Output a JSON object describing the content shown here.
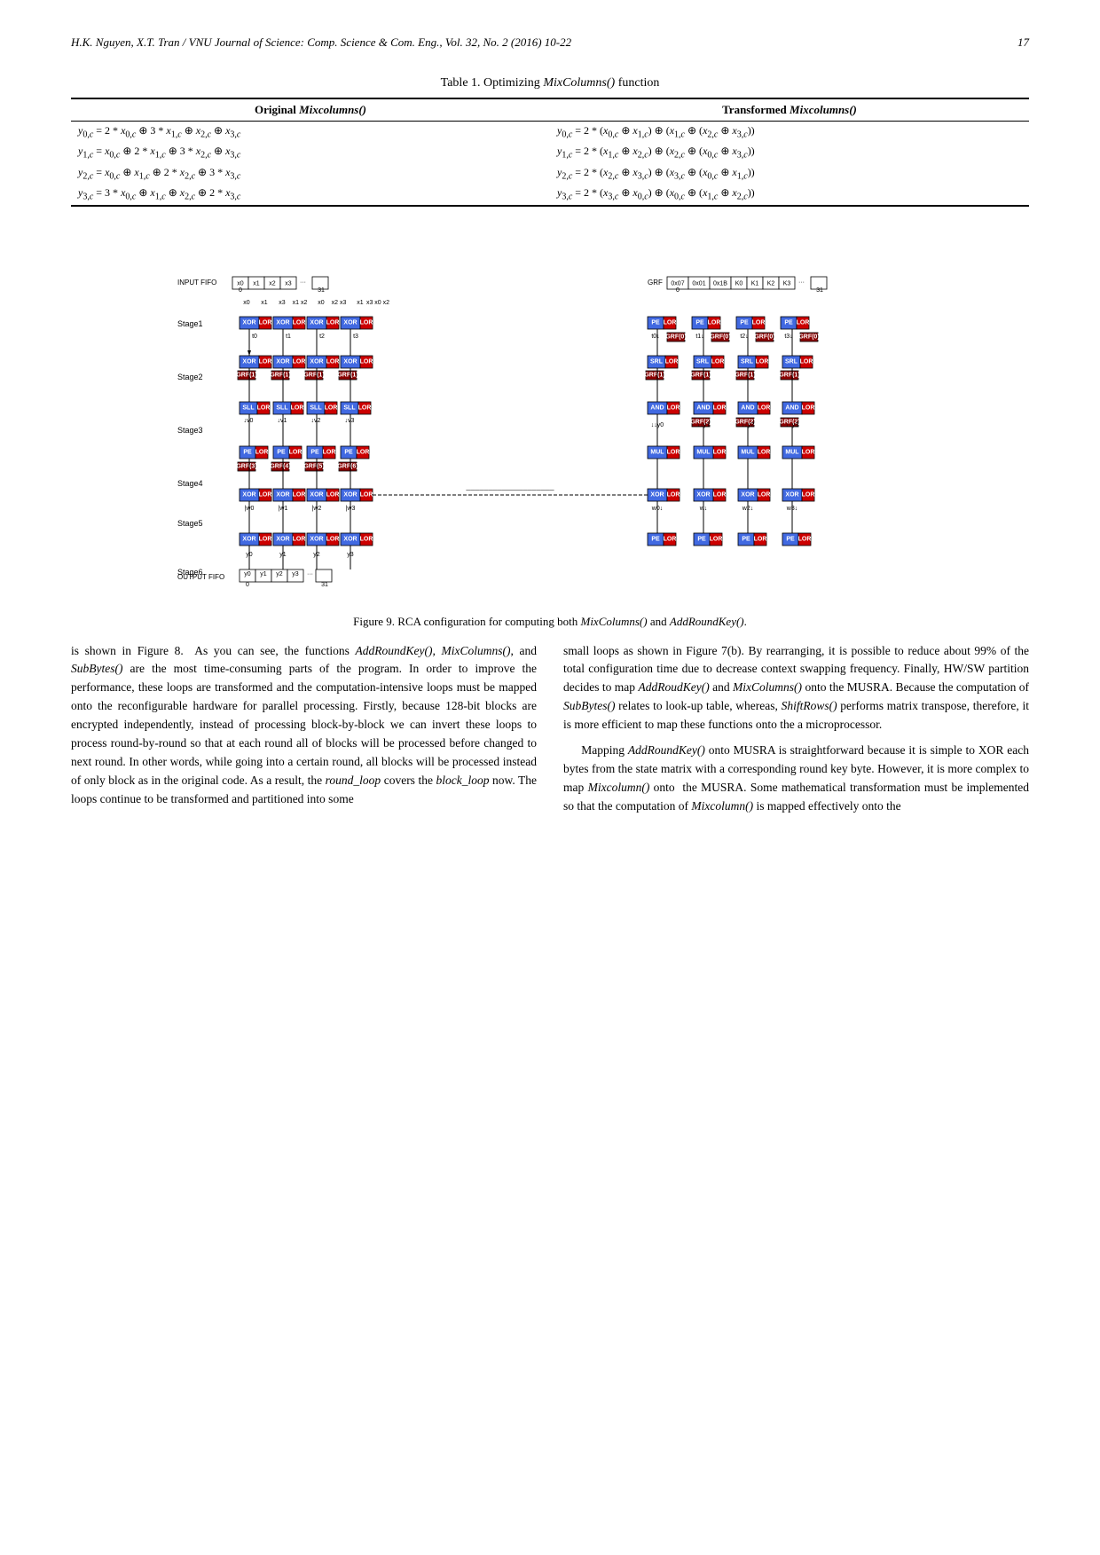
{
  "header": {
    "left": "H.K. Nguyen, X.T. Tran / VNU Journal of Science: Comp. Science & Com. Eng., Vol. 32, No. 2 (2016) 10-22",
    "right": "17"
  },
  "table": {
    "caption": "Table 1. Optimizing MixColumns() function",
    "col_headers": [
      "Original Mixcolumns()",
      "Transformed Mixcolumns()"
    ],
    "rows": [
      {
        "left": "y₀,c = 2 * x₀,c ⊕ 3 * x₁,c ⊕ x₂,c ⊕ x₃,c",
        "right": "y₀,c = 2 * (x₀,c ⊕ x₁,c) ⊕ (x₁,c ⊕ (x₂,c ⊕ x₃,c))"
      },
      {
        "left": "y₁,c = x₀,c ⊕ 2 * x₁,c ⊕ 3 * x₂,c ⊕ x₃,c",
        "right": "y₁,c = 2 * (x₁,c ⊕ x₂,c) ⊕ (x₂,c ⊕ (x₀,c ⊕ x₃,c))"
      },
      {
        "left": "y₂,c = x₀,c ⊕ x₁,c ⊕ 2 * x₂,c ⊕ 3 * x₃,c",
        "right": "y₂,c = 2 * (x₂,c ⊕ x₃,c) ⊕ (x₃,c ⊕ (x₀,c ⊕ x₁,c))"
      },
      {
        "left": "y₃,c = 3 * x₀,c ⊕ x₁,c ⊕ x₂,c ⊕ 2 * x₃,c",
        "right": "y₃,c = 2 * (x₃,c ⊕ x₀,c) ⊕ (x₀,c ⊕ (x₁,c ⊕ x₂,c))"
      }
    ]
  },
  "figure": {
    "caption_text": "Figure 9. RCA configuration for computing both ",
    "caption_func1": "MixColumns()",
    "caption_middle": " and ",
    "caption_func2": "AddRoundKey().",
    "number": "Figure 9"
  },
  "text_left": {
    "paragraphs": [
      "is shown in Figure 8.  As you can see, the functions AddRoundKey(), MixColumns(), and SubBytes() are the most time-consuming parts of the program. In order to improve the performance, these loops are transformed and the computation-intensive loops must be mapped onto the reconfigurable hardware for parallel processing. Firstly, because 128-bit blocks are encrypted independently, instead of processing block-by-block we can invert these loops to process round-by-round so that at each round all of blocks will be processed before changed to next round. In other words, while going into a certain round, all blocks will be processed instead of only block as in the original code. As a result, the round_loop covers the block_loop now. The loops continue to be transformed and partitioned into some"
    ]
  },
  "text_right": {
    "paragraphs": [
      "small loops as shown in Figure 7(b). By rearranging, it is possible to reduce about 99% of the total configuration time due to decrease context swapping frequency. Finally, HW/SW partition decides to map AddRoudKey() and MixColumns() onto the MUSRA. Because the computation of SubBytes() relates to look-up table, whereas, ShiftRows() performs matrix transpose, therefore, it is more efficient to map these functions onto the a microprocessor.",
      "Mapping AddRoundKey() onto MUSRA is straightforward because it is simple to XOR each bytes from the state matrix with a corresponding round key byte. However, it is more complex to map Mixcolumn() onto  the MUSRA. Some mathematical transformation must be implemented so that the computation of Mixcolumn() is mapped effectively onto the"
    ]
  }
}
